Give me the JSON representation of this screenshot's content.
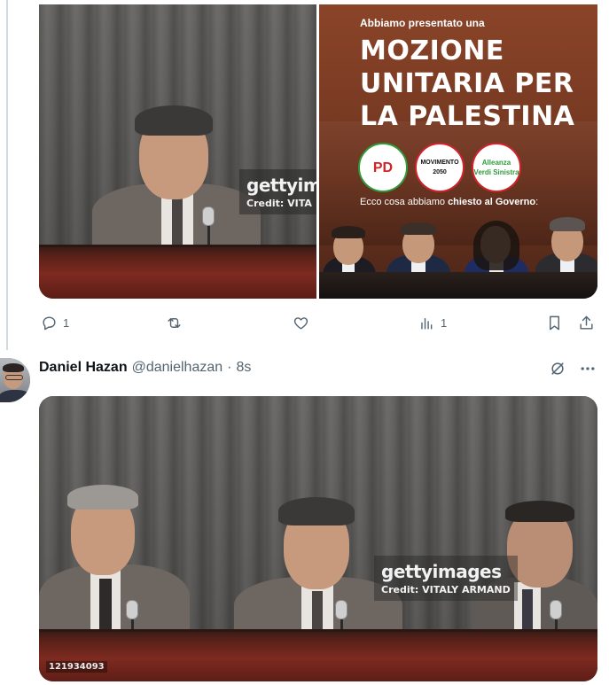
{
  "post1": {
    "photo1": {
      "watermark_logo": "gettyim",
      "watermark_credit": "Credit: VITA"
    },
    "photo2": {
      "intro": "Abbiamo presentato una",
      "title_lines": [
        "MOZIONE",
        "UNITARIA PER",
        "LA PALESTINA"
      ],
      "logos": [
        "PD",
        "MOVIMENTO 2050",
        "Alleanza Verdi Sinistra"
      ],
      "caption_prefix": "Ecco cosa abbiamo ",
      "caption_bold": "chiesto al Governo",
      "caption_suffix": ":"
    },
    "actions": {
      "reply_count": "1",
      "repost_count": "",
      "like_count": "",
      "views_count": "1"
    }
  },
  "post2": {
    "author_name": "Daniel Hazan",
    "author_handle": "@danielhazan",
    "separator": "·",
    "time": "8s",
    "media": {
      "watermark_logo": "gettyimages",
      "watermark_credit": "Credit: VITALY ARMAND",
      "photo_id": "121934093"
    }
  },
  "icons": {
    "reply": "reply-icon",
    "repost": "repost-icon",
    "like": "heart-icon",
    "views": "analytics-icon",
    "bookmark": "bookmark-icon",
    "share": "share-icon",
    "grok": "grok-icon",
    "more": "more-icon"
  },
  "colors": {
    "text_primary": "#0f1419",
    "text_secondary": "#536471",
    "thread_line": "#cfd9de"
  }
}
